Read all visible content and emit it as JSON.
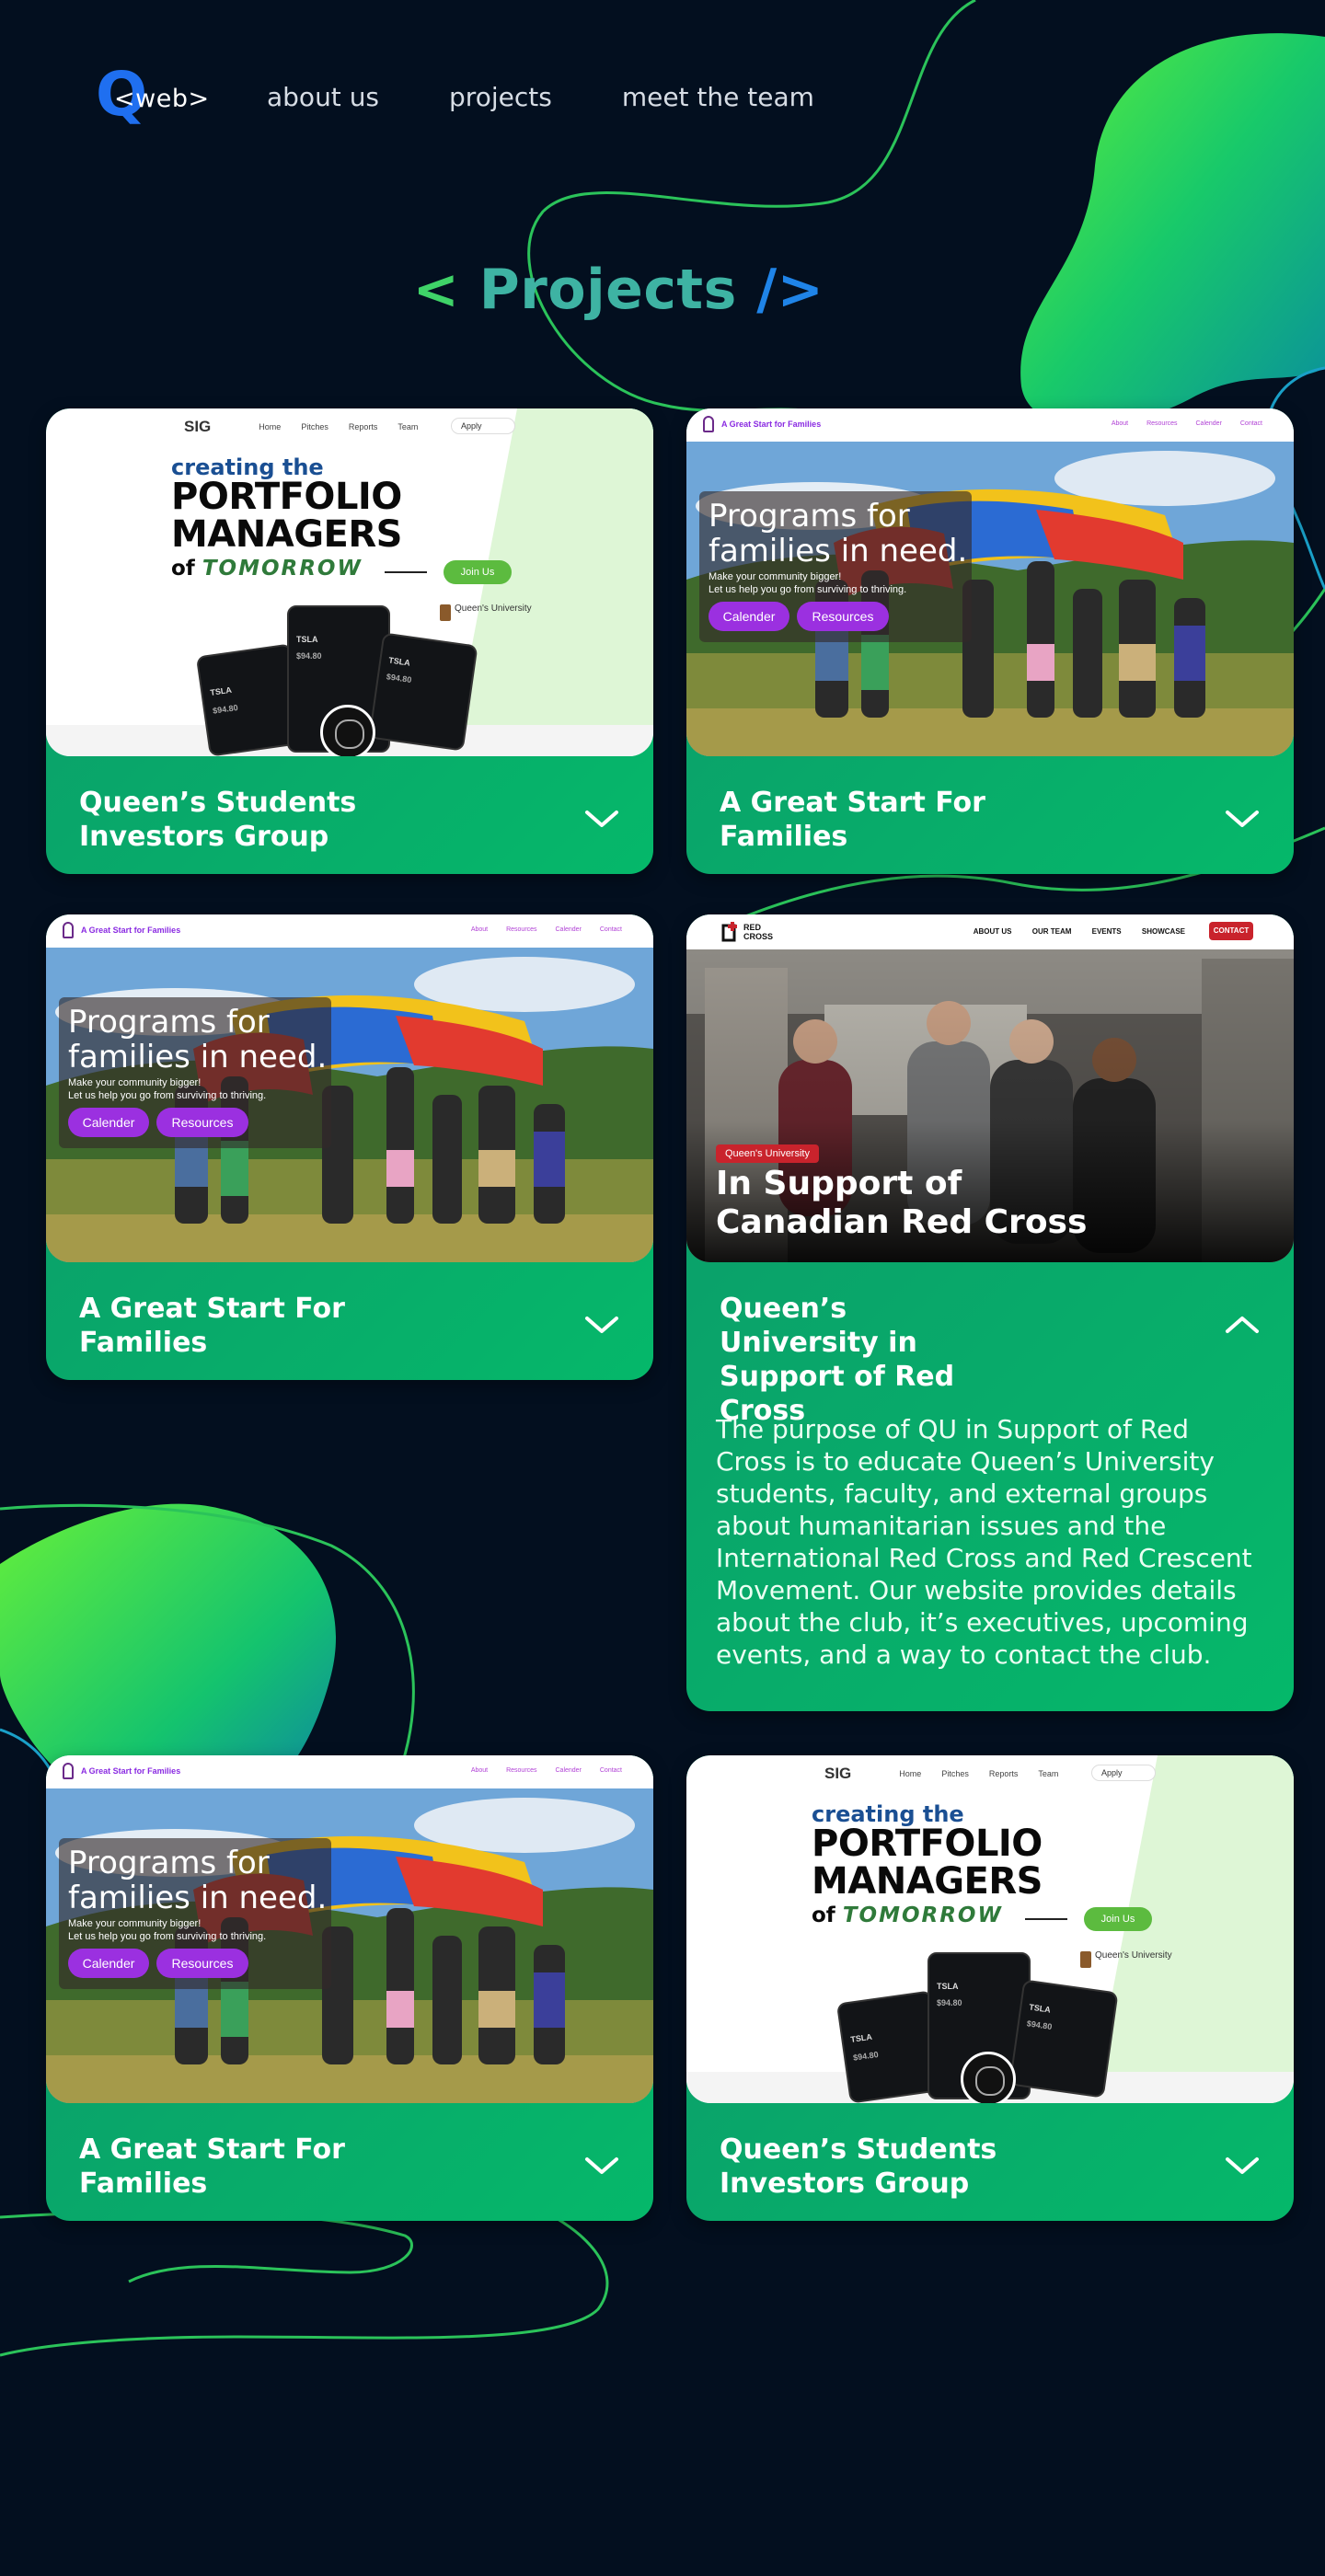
{
  "nav": {
    "logo_q": "Q",
    "logo_text": "<web>",
    "links": [
      "about us",
      "projects",
      "meet the team"
    ]
  },
  "page": {
    "title_open": "<",
    "title_word": "Projects",
    "title_close": "/>"
  },
  "previews": {
    "sig": {
      "brand": "SIG",
      "nav": [
        "Home",
        "Pitches",
        "Reports",
        "Team"
      ],
      "apply": "Apply",
      "line1": "creating the",
      "line2a": "PORTFOLIO",
      "line2b": "MANAGERS",
      "line3_of": "of",
      "line3_em": "TOMORROW",
      "join": "Join Us",
      "university": "Queen's University",
      "ticker": "TSLA",
      "price": "$94.80"
    },
    "families": {
      "site_title": "A Great Start for Families",
      "nav": [
        "About",
        "Resources",
        "Calender",
        "Contact"
      ],
      "headline": "Programs for families in need.",
      "sub1": "Make your community bigger!",
      "sub2": "Let us help you go from surviving to thriving.",
      "btn1": "Calender",
      "btn2": "Resources"
    },
    "redcross": {
      "logo_line1": "RED",
      "logo_line2": "CROSS",
      "nav": [
        "ABOUT US",
        "OUR TEAM",
        "EVENTS",
        "SHOWCASE"
      ],
      "contact": "CONTACT",
      "badge": "Queen's University",
      "headline_1": "In Support of",
      "headline_2": "Canadian Red Cross"
    }
  },
  "cards": [
    {
      "title": "Queen’s Students Investors Group",
      "expanded": false
    },
    {
      "title": "A Great Start For Families",
      "expanded": false
    },
    {
      "title": "A Great Start For Families",
      "expanded": false
    },
    {
      "title": "Queen’s University in Support of Red Cross",
      "expanded": true,
      "description": "The purpose of QU in Support of Red Cross is to educate Queen’s University students, faculty, and external groups about humanitarian issues and the International Red Cross and Red Crescent Movement. Our website provides details about the club, it’s executives, upcoming events, and a way to contact the club."
    },
    {
      "title": "A Great Start For Families",
      "expanded": false
    },
    {
      "title": "Queen’s Students Investors Group",
      "expanded": false
    }
  ],
  "colors": {
    "background": "#030f1f",
    "card_green": "#05b86a",
    "accent_green": "#3fd368",
    "accent_blue": "#1f84e8",
    "purple_button": "#9b30e0",
    "red_cross": "#c9232c"
  }
}
